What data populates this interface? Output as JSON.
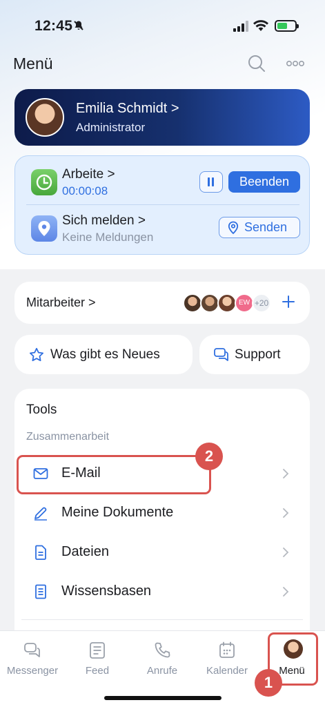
{
  "status": {
    "time": "12:45"
  },
  "header": {
    "title": "Menü"
  },
  "profile": {
    "name": "Emilia Schmidt >",
    "role": "Administrator"
  },
  "work": {
    "title": "Arbeite >",
    "timer": "00:00:08",
    "end_label": "Beenden",
    "report_title": "Sich melden >",
    "report_sub": "Keine Meldungen",
    "send_label": "Senden"
  },
  "staff": {
    "label": "Mitarbeiter >",
    "avatar_initials": "EW",
    "extra_count": "+20"
  },
  "quick": {
    "news_label": "Was gibt es Neues",
    "support_label": "Support"
  },
  "tools": {
    "title": "Tools",
    "section": "Zusammenarbeit",
    "items": [
      {
        "label": "E-Mail",
        "icon": "mail-icon"
      },
      {
        "label": "Meine Dokumente",
        "icon": "pen-icon"
      },
      {
        "label": "Dateien",
        "icon": "file-icon"
      },
      {
        "label": "Wissensbasen",
        "icon": "book-icon"
      }
    ]
  },
  "tabs": [
    {
      "label": "Messenger",
      "icon": "chat-icon"
    },
    {
      "label": "Feed",
      "icon": "feed-icon"
    },
    {
      "label": "Anrufe",
      "icon": "phone-icon"
    },
    {
      "label": "Kalender",
      "icon": "calendar-icon"
    },
    {
      "label": "Menü",
      "icon": "avatar",
      "active": true
    }
  ],
  "annotations": {
    "badge_1": "1",
    "badge_2": "2"
  },
  "colors": {
    "accent": "#2f6fe0",
    "highlight": "#d9534f",
    "profile_bg": "#16306e"
  }
}
